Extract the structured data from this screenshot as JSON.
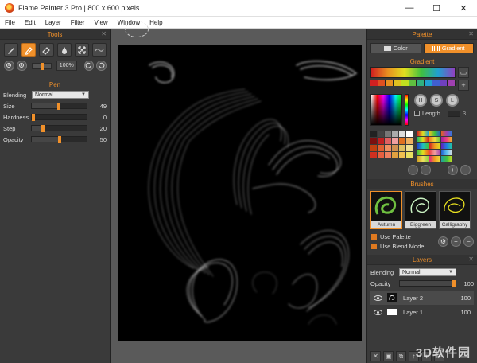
{
  "window": {
    "title": "Flame Painter 3 Pro | 800 x 600 pixels",
    "minimize_glyph": "—",
    "maximize_glyph": "☐",
    "close_glyph": "✕"
  },
  "menu": [
    "File",
    "Edit",
    "Layer",
    "Filter",
    "View",
    "Window",
    "Help"
  ],
  "tools_panel": {
    "title": "Tools",
    "zoom_percent": "100%",
    "zoom_level": 0.45
  },
  "pen_panel": {
    "title": "Pen",
    "blending_label": "Blending",
    "blending_value": "Normal",
    "properties": [
      {
        "label": "Size",
        "value": "49",
        "level": 0.49
      },
      {
        "label": "Hardness",
        "value": "0",
        "level": 0.0
      },
      {
        "label": "Step",
        "value": "20",
        "level": 0.2
      },
      {
        "label": "Opacity",
        "value": "50",
        "level": 0.5
      }
    ]
  },
  "palette_panel": {
    "title": "Palette",
    "color_tab": "Color",
    "gradient_tab": "Gradient",
    "gradient_head": "Gradient",
    "hsl": [
      "H",
      "S",
      "L"
    ],
    "length_label": "Length",
    "length_value": "3"
  },
  "brushes_panel": {
    "title": "Brushes",
    "brushes": [
      "Autumn",
      "Biggreen",
      "Calligraphy"
    ],
    "use_palette": "Use Palette",
    "use_blend_mode": "Use Blend Mode"
  },
  "layers_panel": {
    "title": "Layers",
    "blending_label": "Blending",
    "blending_value": "Normal",
    "opacity_label": "Opacity",
    "opacity_value": "100",
    "layers": [
      {
        "name": "Layer 2",
        "opacity": "100"
      },
      {
        "name": "Layer 1",
        "opacity": "100"
      }
    ]
  },
  "watermark": "3D软件园",
  "colors": {
    "accent": "#f0902a",
    "panel_bg": "#3a3a3a",
    "canvas_bg": "#000000",
    "workspace_bg": "#5a5a5a"
  }
}
